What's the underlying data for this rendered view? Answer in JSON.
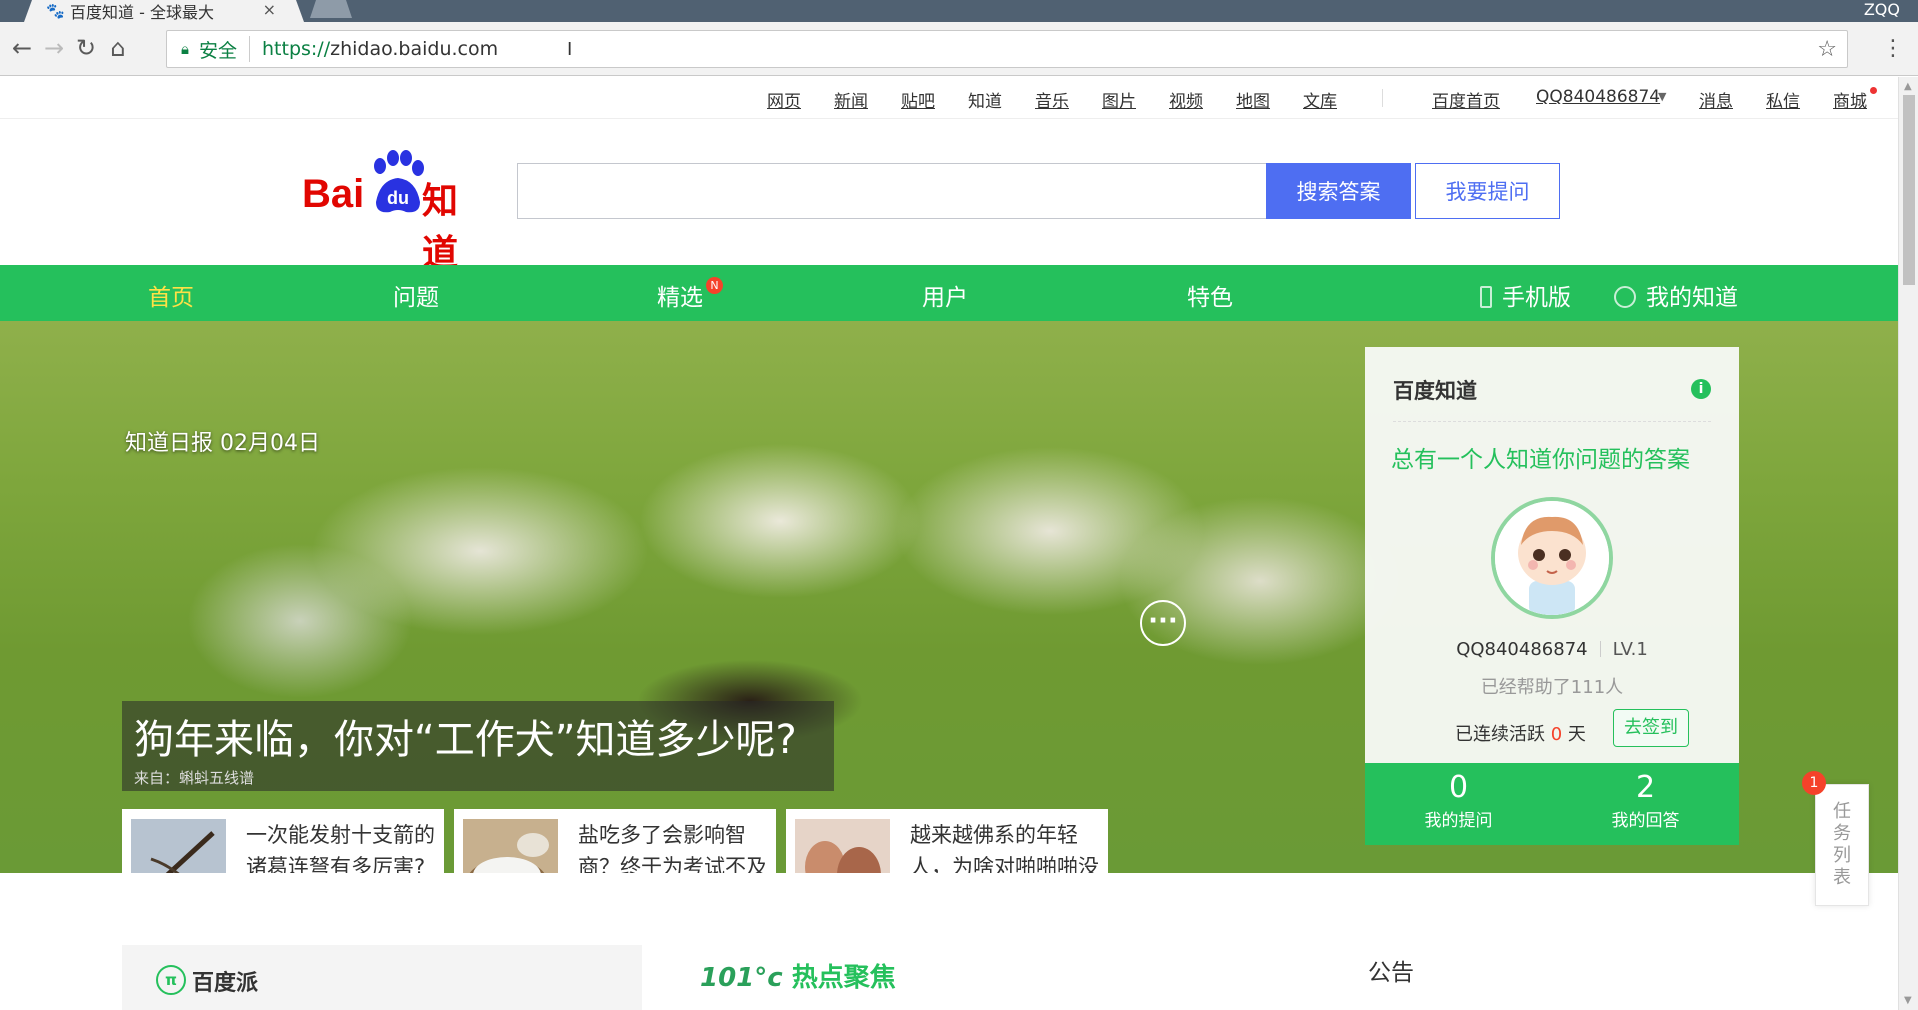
{
  "browser": {
    "tab_title": "百度知道 - 全球最大",
    "tab_close": "×",
    "profile_name": "ZQQ",
    "secure_label": "安全",
    "url_scheme": "https://",
    "url_host": "zhidao.baidu.com"
  },
  "toplinks": [
    {
      "label": "网页",
      "underlined": true
    },
    {
      "label": "新闻",
      "underlined": true
    },
    {
      "label": "贴吧",
      "underlined": true
    },
    {
      "label": "知道",
      "underlined": false
    },
    {
      "label": "音乐",
      "underlined": true
    },
    {
      "label": "图片",
      "underlined": true
    },
    {
      "label": "视频",
      "underlined": true
    },
    {
      "label": "地图",
      "underlined": true
    },
    {
      "label": "文库",
      "underlined": true
    }
  ],
  "account": {
    "home_link": "百度首页",
    "username": "QQ840486874",
    "messages": "消息",
    "private_msg": "私信",
    "mall": "商城"
  },
  "search": {
    "logo_bai": "Bai",
    "logo_du": "du",
    "logo_zhidao": "知道",
    "search_button": "搜索答案",
    "ask_button": "我要提问"
  },
  "nav": {
    "items": [
      "首页",
      "问题",
      "精选",
      "用户",
      "特色"
    ],
    "active_index": 0,
    "new_badge": "N",
    "mobile": "手机版",
    "my_zhidao": "我的知道",
    "active_color": "#ffe146",
    "bar_color": "#25c05c"
  },
  "banner": {
    "date_label": "知道日报 02月04日",
    "headline": "狗年来临，你对“工作犬”知道多少呢?",
    "source": "来自：蝌蚪五线谱",
    "cards": [
      {
        "text": "一次能发射十支箭的诸葛连弩有多厉害?",
        "thumb": "crossbow"
      },
      {
        "text": "盐吃多了会影响智商？终于为考试不及格找到借口了",
        "thumb": "salt"
      },
      {
        "text": "越来越佛系的年轻人，为啥对啪啪啪没性趣了?",
        "thumb": "couple"
      }
    ],
    "more": "···"
  },
  "panel": {
    "title": "百度知道",
    "info_icon": "i",
    "slogan": "总有一个人知道你问题的答案",
    "username": "QQ840486874",
    "level": "LV.1",
    "helped": "已经帮助了111人",
    "streak_prefix": "已连续活跃",
    "streak_days": "0",
    "streak_suffix": "天",
    "signin": "去签到",
    "questions_count": "0",
    "questions_label": "我的提问",
    "answers_count": "2",
    "answers_label": "我的回答"
  },
  "tasklist": {
    "label": "任务列表",
    "badge": "1"
  },
  "sections": {
    "baidupai_icon": "π",
    "baidupai": "百度派",
    "hot_prefix": "101°c",
    "hot_title": "热点聚焦",
    "notice": "公告"
  }
}
